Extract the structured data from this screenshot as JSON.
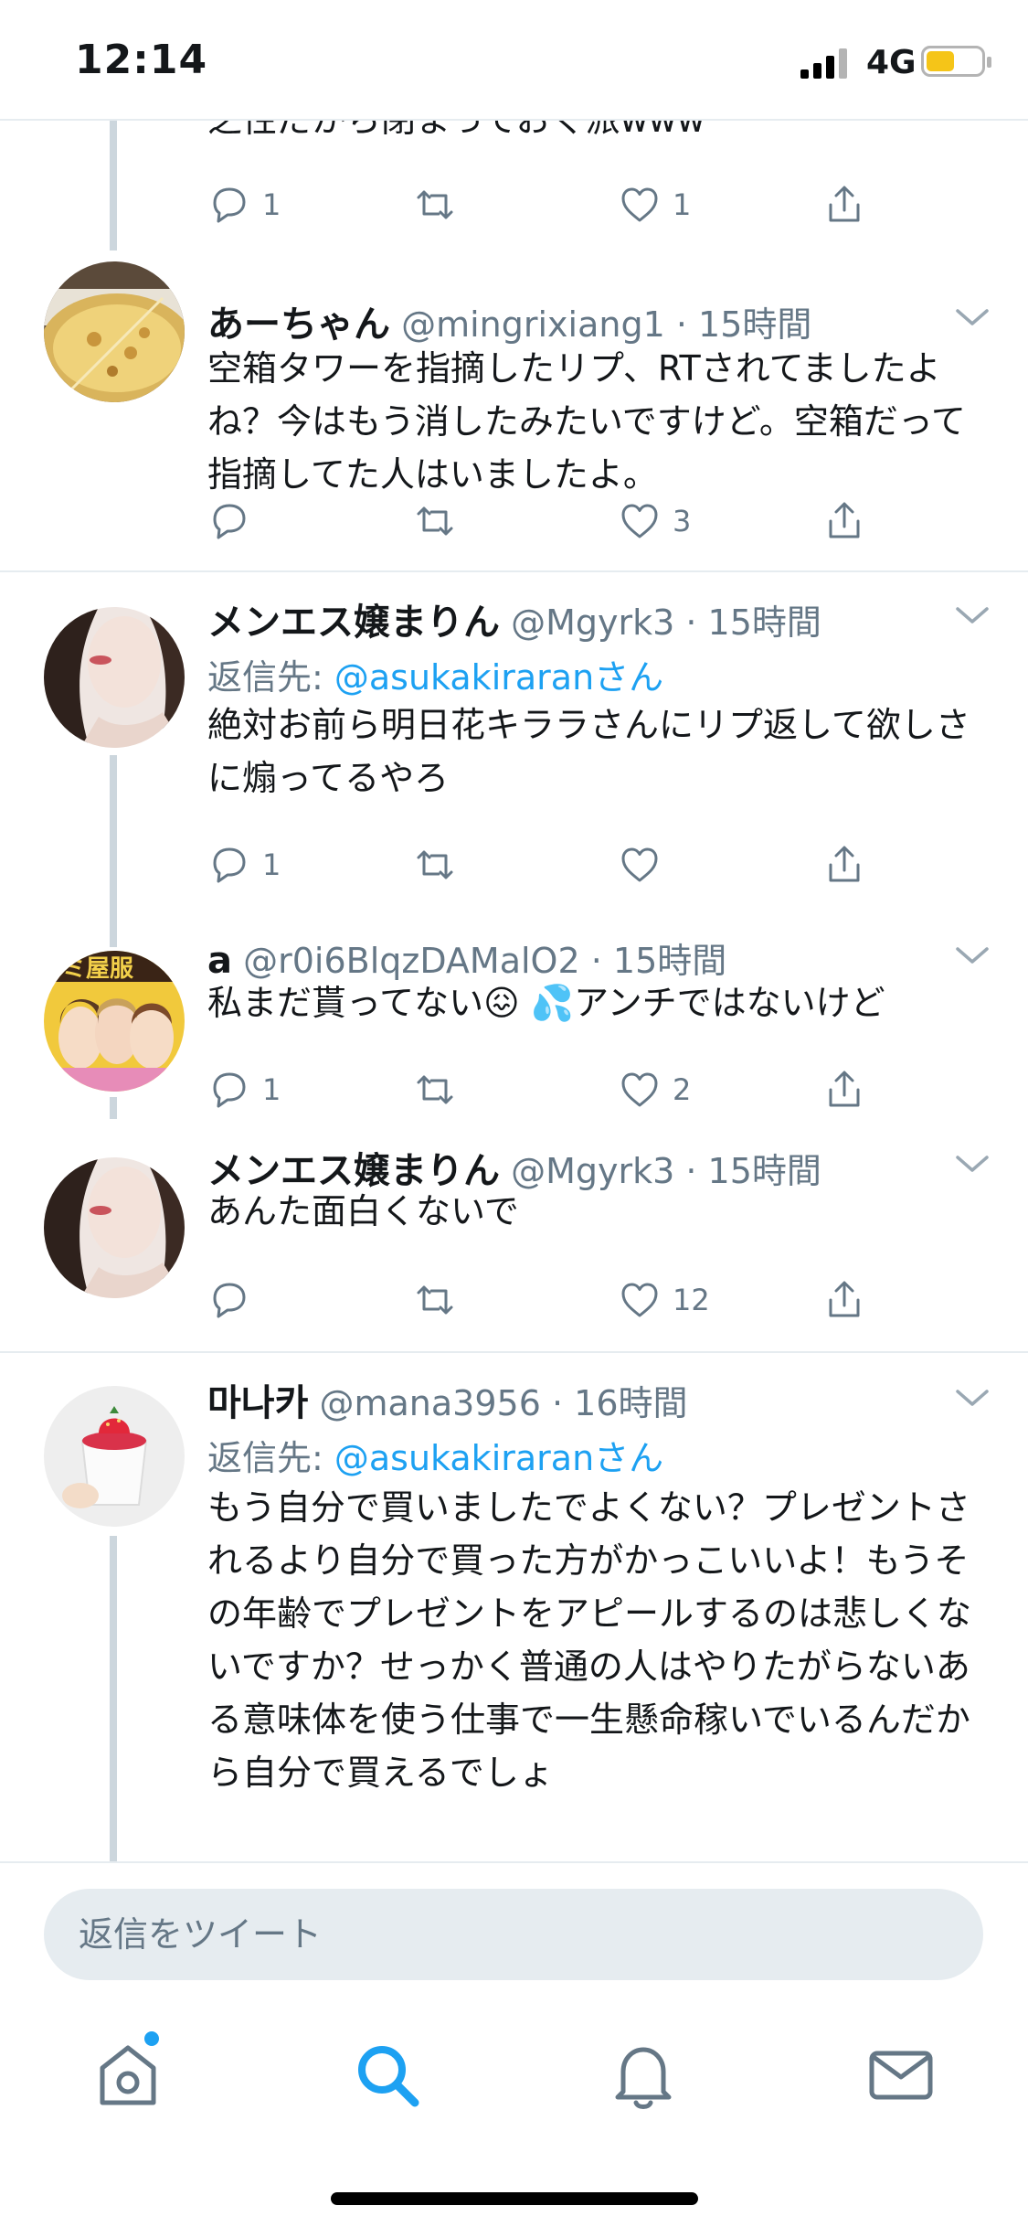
{
  "status_bar": {
    "time": "12:14",
    "network": "4G"
  },
  "colors": {
    "accent": "#1da1f2",
    "text": "#14171a",
    "muted": "#657786",
    "divider": "#e6ecf0",
    "thread": "#ccd6dd"
  },
  "tweets": [
    {
      "body": "之性だから閉まっておく派www",
      "reply_count": "1",
      "like_count": "1"
    },
    {
      "name": "あーちゃん",
      "handle": "@mingrixiang1",
      "time": "· 15時間",
      "body": "空箱タワーを指摘したリプ、RTされてましたよね？今はもう消したみたいですけど。空箱だって指摘してた人はいましたよ。",
      "reply_count": "",
      "like_count": "3"
    },
    {
      "name": "メンエス嬢まりん",
      "handle": "@Mgyrk3",
      "time": "· 15時間",
      "reply_prefix": "返信先: ",
      "reply_mention": "@asukakiraranさん",
      "body": "絶対お前ら明日花キララさんにリプ返して欲しさに煽ってるやろ",
      "reply_count": "1",
      "like_count": ""
    },
    {
      "name": "a",
      "handle": "@r0i6BlqzDAMalO2",
      "time": "· 15時間",
      "body": "私まだ貰ってない😖 💦アンチではないけど",
      "reply_count": "1",
      "like_count": "2"
    },
    {
      "name": "メンエス嬢まりん",
      "handle": "@Mgyrk3",
      "time": "· 15時間",
      "body": "あんた面白くないで",
      "reply_count": "",
      "like_count": "12"
    },
    {
      "name": "마나카",
      "handle": "@mana3956",
      "time": "· 16時間",
      "reply_prefix": "返信先: ",
      "reply_mention": "@asukakiraranさん",
      "body": "もう自分で買いましたでよくない？プレゼントされるより自分で買った方がかっこいいよ！もうその年齢でプレゼントをアピールするのは悲しくないですか？せっかく普通の人はやりたがらないある意味体を使う仕事で一生懸命稼いでいるんだから自分で買えるでしょ"
    }
  ],
  "composer": {
    "placeholder": "返信をツイート"
  },
  "tabbar": {
    "icons": [
      "home-icon",
      "search-icon",
      "notifications-icon",
      "messages-icon"
    ],
    "active": "search-icon"
  }
}
